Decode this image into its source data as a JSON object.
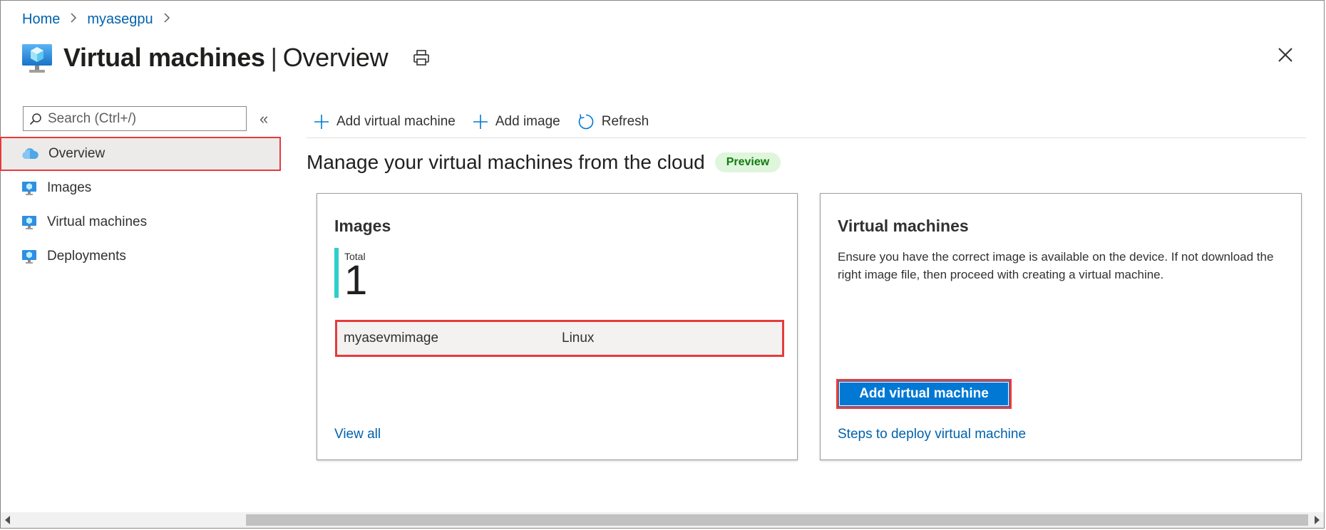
{
  "breadcrumb": {
    "items": [
      "Home",
      "myasegpu"
    ]
  },
  "header": {
    "title_main": "Virtual machines",
    "title_sep": "|",
    "title_sub": "Overview"
  },
  "sidebar": {
    "search_placeholder": "Search (Ctrl+/)",
    "collapse_glyph": "«",
    "items": [
      {
        "label": "Overview",
        "icon": "cloud-icon",
        "active": true
      },
      {
        "label": "Images",
        "icon": "monitor-icon"
      },
      {
        "label": "Virtual machines",
        "icon": "monitor-icon"
      },
      {
        "label": "Deployments",
        "icon": "monitor-icon"
      }
    ]
  },
  "commands": {
    "add_vm": "Add virtual machine",
    "add_image": "Add image",
    "refresh": "Refresh"
  },
  "main": {
    "heading": "Manage your virtual machines from the cloud",
    "badge": "Preview"
  },
  "images_card": {
    "title": "Images",
    "total_label": "Total",
    "total_value": "1",
    "rows": [
      {
        "name": "myasevmimage",
        "os": "Linux"
      }
    ],
    "view_all": "View all"
  },
  "vms_card": {
    "title": "Virtual machines",
    "description": "Ensure you have the correct image is available on the device. If not download the right image file, then proceed with creating a virtual machine.",
    "button": "Add virtual machine",
    "steps_link": "Steps to deploy virtual machine"
  },
  "colors": {
    "accent": "#0078d4",
    "link": "#0062ad",
    "highlight": "#e63b3b",
    "total_bar": "#2ecfca",
    "badge_bg": "#dff6dd",
    "badge_fg": "#107c10"
  }
}
